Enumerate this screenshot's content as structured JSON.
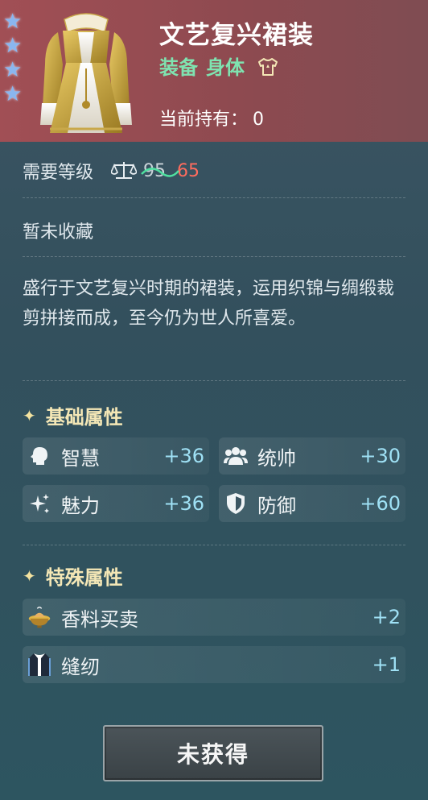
{
  "item": {
    "name": "文艺复兴裙装",
    "category": "装备",
    "slot": "身体",
    "owned_label": "当前持有：",
    "owned_count": "0",
    "stars": 4
  },
  "requirement": {
    "label": "需要等级",
    "old_level": "95",
    "new_level": "65"
  },
  "collection_status": "暂未收藏",
  "description": "盛行于文艺复兴时期的裙装，运用织锦与绸缎裁剪拼接而成，至今仍为世人所喜爱。",
  "base_attributes": {
    "title": "基础属性",
    "items": [
      {
        "name": "智慧",
        "value": "+36",
        "icon": "head-icon"
      },
      {
        "name": "统帅",
        "value": "+30",
        "icon": "group-icon"
      },
      {
        "name": "魅力",
        "value": "+36",
        "icon": "sparkle-icon"
      },
      {
        "name": "防御",
        "value": "+60",
        "icon": "shield-icon"
      }
    ]
  },
  "special_attributes": {
    "title": "特殊属性",
    "items": [
      {
        "name": "香料买卖",
        "value": "+2",
        "icon": "spice-bowl-icon"
      },
      {
        "name": "缝纫",
        "value": "+1",
        "icon": "sewing-vest-icon"
      }
    ]
  },
  "action_button": "未获得",
  "colors": {
    "header": "#a14f55",
    "subtitle_green": "#7fe3b0",
    "new_level_red": "#ff6c5e",
    "stat_value": "#9fe1f5",
    "section_title": "#f4e7b6"
  }
}
